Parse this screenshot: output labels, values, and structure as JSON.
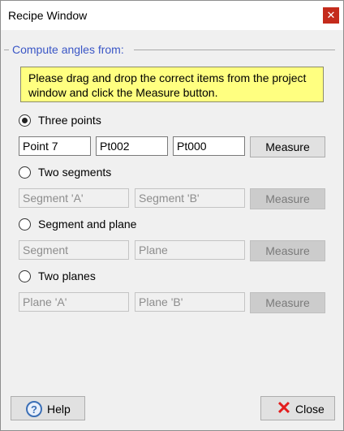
{
  "window": {
    "title": "Recipe Window",
    "close_glyph": "✕"
  },
  "group": {
    "title": "Compute angles from:"
  },
  "note": "Please drag and drop the correct items from the project window and click the Measure button.",
  "options": [
    {
      "label": "Three points",
      "checked": true,
      "fields": [
        "Point 7",
        "Pt002",
        "Pt000"
      ],
      "measure": "Measure"
    },
    {
      "label": "Two segments",
      "checked": false,
      "fields": [
        "Segment 'A'",
        "Segment 'B'"
      ],
      "measure": "Measure"
    },
    {
      "label": "Segment and plane",
      "checked": false,
      "fields": [
        "Segment",
        "Plane"
      ],
      "measure": "Measure"
    },
    {
      "label": "Two planes",
      "checked": false,
      "fields": [
        "Plane 'A'",
        "Plane 'B'"
      ],
      "measure": "Measure"
    }
  ],
  "footer": {
    "help_label": "Help",
    "help_icon": "?",
    "close_label": "Close",
    "close_icon": "✕"
  },
  "colors": {
    "accent": "#3a56c6",
    "note_bg": "#ffff80",
    "close_red": "#c42b1c"
  }
}
